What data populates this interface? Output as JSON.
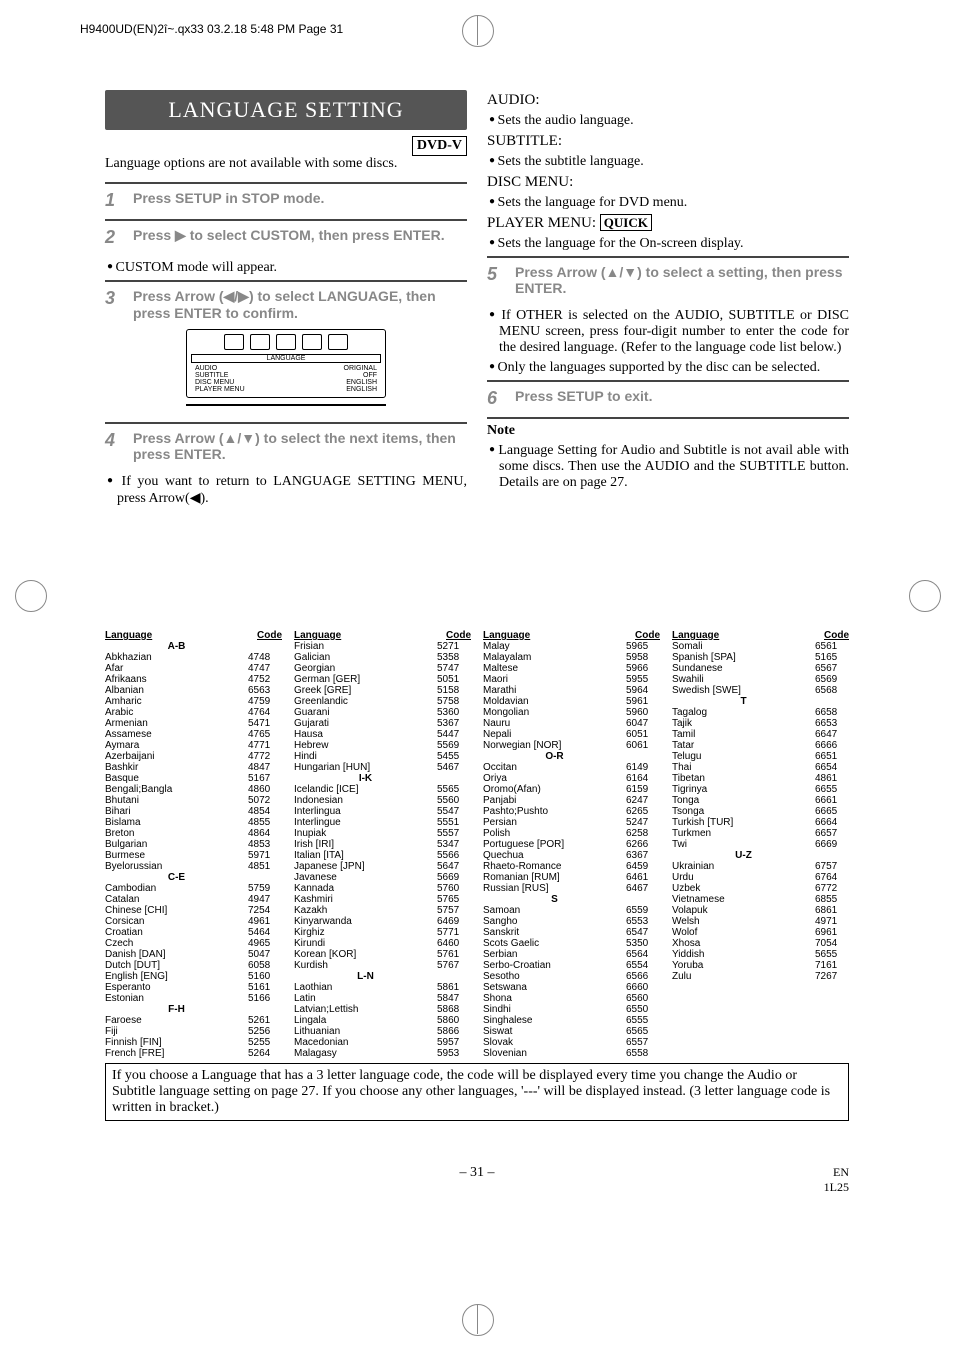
{
  "meta": {
    "header": "H9400UD(EN)2î~.qx33  03.2.18 5:48 PM  Page 31"
  },
  "left": {
    "title": "LANGUAGE SETTING",
    "badge": "DVD-V",
    "intro": "Language options are not available with some discs.",
    "step1": "Press SETUP in STOP mode.",
    "step2": "Press ▶ to select CUSTOM, then press ENTER.",
    "bullet2": "CUSTOM mode will appear.",
    "step3": "Press Arrow (◀/▶) to select LANGUAGE, then press ENTER to confirm.",
    "osd": {
      "label": "LANGUAGE",
      "rows": [
        {
          "k": "AUDIO",
          "v": "ORIGINAL"
        },
        {
          "k": "SUBTITLE",
          "v": "OFF"
        },
        {
          "k": "DISC MENU",
          "v": "ENGLISH"
        },
        {
          "k": "PLAYER MENU",
          "v": "ENGLISH"
        }
      ]
    },
    "step4": "Press Arrow (▲/▼) to select the next items, then press ENTER.",
    "bullet4": "If you want to return to LANGUAGE SETTING MENU, press Arrow(◀)."
  },
  "right": {
    "audio_h": "AUDIO:",
    "audio_b": "Sets the audio language.",
    "sub_h": "SUBTITLE:",
    "sub_b": "Sets the subtitle language.",
    "disc_h": "DISC MENU:",
    "disc_b": "Sets the language for DVD menu.",
    "player_h": "PLAYER MENU:",
    "quick": "QUICK",
    "player_b": "Sets the language for the On-screen display.",
    "step5": "Press Arrow (▲/▼) to select a setting, then press ENTER.",
    "bullet5a": "If OTHER is selected on the AUDIO, SUBTITLE or DISC MENU screen, press four-digit number to enter the code for the desired language. (Refer to the language code list below.)",
    "bullet5b": "Only the languages supported by the disc can be selected.",
    "step6": "Press SETUP to exit.",
    "note_h": "Note",
    "note_b": "Language Setting for Audio and Subtitle is not avail able with some discs. Then use the AUDIO and the SUBTITLE button. Details are on page 27."
  },
  "table": {
    "hdr_lang": "Language",
    "hdr_code": "Code",
    "col1": [
      {
        "s": "A-B"
      },
      {
        "l": "Abkhazian",
        "c": "4748"
      },
      {
        "l": "Afar",
        "c": "4747"
      },
      {
        "l": "Afrikaans",
        "c": "4752"
      },
      {
        "l": "Albanian",
        "c": "6563"
      },
      {
        "l": "Amharic",
        "c": "4759"
      },
      {
        "l": "Arabic",
        "c": "4764"
      },
      {
        "l": "Armenian",
        "c": "5471"
      },
      {
        "l": "Assamese",
        "c": "4765"
      },
      {
        "l": "Aymara",
        "c": "4771"
      },
      {
        "l": "Azerbaijani",
        "c": "4772"
      },
      {
        "l": "Bashkir",
        "c": "4847"
      },
      {
        "l": "Basque",
        "c": "5167"
      },
      {
        "l": "Bengali;Bangla",
        "c": "4860"
      },
      {
        "l": "Bhutani",
        "c": "5072"
      },
      {
        "l": "Bihari",
        "c": "4854"
      },
      {
        "l": "Bislama",
        "c": "4855"
      },
      {
        "l": "Breton",
        "c": "4864"
      },
      {
        "l": "Bulgarian",
        "c": "4853"
      },
      {
        "l": "Burmese",
        "c": "5971"
      },
      {
        "l": "Byelorussian",
        "c": "4851"
      },
      {
        "s": "C-E"
      },
      {
        "l": "Cambodian",
        "c": "5759"
      },
      {
        "l": "Catalan",
        "c": "4947"
      },
      {
        "l": "Chinese [CHI]",
        "c": "7254"
      },
      {
        "l": "Corsican",
        "c": "4961"
      },
      {
        "l": "Croatian",
        "c": "5464"
      },
      {
        "l": "Czech",
        "c": "4965"
      },
      {
        "l": "Danish [DAN]",
        "c": "5047"
      },
      {
        "l": "Dutch [DUT]",
        "c": "6058"
      },
      {
        "l": "English [ENG]",
        "c": "5160"
      },
      {
        "l": "Esperanto",
        "c": "5161"
      },
      {
        "l": "Estonian",
        "c": "5166"
      },
      {
        "s": "F-H"
      },
      {
        "l": "Faroese",
        "c": "5261"
      },
      {
        "l": "Fiji",
        "c": "5256"
      },
      {
        "l": "Finnish [FIN]",
        "c": "5255"
      },
      {
        "l": "French [FRE]",
        "c": "5264"
      }
    ],
    "col2": [
      {
        "l": "Frisian",
        "c": "5271"
      },
      {
        "l": "Galician",
        "c": "5358"
      },
      {
        "l": "Georgian",
        "c": "5747"
      },
      {
        "l": "German [GER]",
        "c": "5051"
      },
      {
        "l": "Greek [GRE]",
        "c": "5158"
      },
      {
        "l": "Greenlandic",
        "c": "5758"
      },
      {
        "l": "Guarani",
        "c": "5360"
      },
      {
        "l": "Gujarati",
        "c": "5367"
      },
      {
        "l": "Hausa",
        "c": "5447"
      },
      {
        "l": "Hebrew",
        "c": "5569"
      },
      {
        "l": "Hindi",
        "c": "5455"
      },
      {
        "l": "Hungarian [HUN]",
        "c": "5467"
      },
      {
        "s": "I-K"
      },
      {
        "l": "Icelandic [ICE]",
        "c": "5565"
      },
      {
        "l": "Indonesian",
        "c": "5560"
      },
      {
        "l": "Interlingua",
        "c": "5547"
      },
      {
        "l": "Interlingue",
        "c": "5551"
      },
      {
        "l": "Inupiak",
        "c": "5557"
      },
      {
        "l": "Irish [IRI]",
        "c": "5347"
      },
      {
        "l": "Italian [ITA]",
        "c": "5566"
      },
      {
        "l": "Japanese [JPN]",
        "c": "5647"
      },
      {
        "l": "Javanese",
        "c": "5669"
      },
      {
        "l": "Kannada",
        "c": "5760"
      },
      {
        "l": "Kashmiri",
        "c": "5765"
      },
      {
        "l": "Kazakh",
        "c": "5757"
      },
      {
        "l": "Kinyarwanda",
        "c": "6469"
      },
      {
        "l": "Kirghiz",
        "c": "5771"
      },
      {
        "l": "Kirundi",
        "c": "6460"
      },
      {
        "l": "Korean [KOR]",
        "c": "5761"
      },
      {
        "l": "Kurdish",
        "c": "5767"
      },
      {
        "s": "L-N"
      },
      {
        "l": "Laothian",
        "c": "5861"
      },
      {
        "l": "Latin",
        "c": "5847"
      },
      {
        "l": "Latvian;Lettish",
        "c": "5868"
      },
      {
        "l": "Lingala",
        "c": "5860"
      },
      {
        "l": "Lithuanian",
        "c": "5866"
      },
      {
        "l": "Macedonian",
        "c": "5957"
      },
      {
        "l": "Malagasy",
        "c": "5953"
      }
    ],
    "col3": [
      {
        "l": "Malay",
        "c": "5965"
      },
      {
        "l": "Malayalam",
        "c": "5958"
      },
      {
        "l": "Maltese",
        "c": "5966"
      },
      {
        "l": "Maori",
        "c": "5955"
      },
      {
        "l": "Marathi",
        "c": "5964"
      },
      {
        "l": "Moldavian",
        "c": "5961"
      },
      {
        "l": "Mongolian",
        "c": "5960"
      },
      {
        "l": "Nauru",
        "c": "6047"
      },
      {
        "l": "Nepali",
        "c": "6051"
      },
      {
        "l": "Norwegian [NOR]",
        "c": "6061"
      },
      {
        "s": "O-R"
      },
      {
        "l": "Occitan",
        "c": "6149"
      },
      {
        "l": "Oriya",
        "c": "6164"
      },
      {
        "l": "Oromo(Afan)",
        "c": "6159"
      },
      {
        "l": "Panjabi",
        "c": "6247"
      },
      {
        "l": "Pashto;Pushto",
        "c": "6265"
      },
      {
        "l": "Persian",
        "c": "5247"
      },
      {
        "l": "Polish",
        "c": "6258"
      },
      {
        "l": "Portuguese [POR]",
        "c": "6266"
      },
      {
        "l": "Quechua",
        "c": "6367"
      },
      {
        "l": "Rhaeto-Romance",
        "c": "6459"
      },
      {
        "l": "Romanian [RUM]",
        "c": "6461"
      },
      {
        "l": "Russian [RUS]",
        "c": "6467"
      },
      {
        "s": "S"
      },
      {
        "l": "Samoan",
        "c": "6559"
      },
      {
        "l": "Sangho",
        "c": "6553"
      },
      {
        "l": "Sanskrit",
        "c": "6547"
      },
      {
        "l": "Scots Gaelic",
        "c": "5350"
      },
      {
        "l": "Serbian",
        "c": "6564"
      },
      {
        "l": "Serbo-Croatian",
        "c": "6554"
      },
      {
        "l": "Sesotho",
        "c": "6566"
      },
      {
        "l": "Setswana",
        "c": "6660"
      },
      {
        "l": "Shona",
        "c": "6560"
      },
      {
        "l": "Sindhi",
        "c": "6550"
      },
      {
        "l": "Singhalese",
        "c": "6555"
      },
      {
        "l": "Siswat",
        "c": "6565"
      },
      {
        "l": "Slovak",
        "c": "6557"
      },
      {
        "l": "Slovenian",
        "c": "6558"
      }
    ],
    "col4": [
      {
        "l": "Somali",
        "c": "6561"
      },
      {
        "l": "Spanish [SPA]",
        "c": "5165"
      },
      {
        "l": "Sundanese",
        "c": "6567"
      },
      {
        "l": "Swahili",
        "c": "6569"
      },
      {
        "l": "Swedish [SWE]",
        "c": "6568"
      },
      {
        "s": "T"
      },
      {
        "l": "Tagalog",
        "c": "6658"
      },
      {
        "l": "Tajik",
        "c": "6653"
      },
      {
        "l": "Tamil",
        "c": "6647"
      },
      {
        "l": "Tatar",
        "c": "6666"
      },
      {
        "l": "Telugu",
        "c": "6651"
      },
      {
        "l": "Thai",
        "c": "6654"
      },
      {
        "l": "Tibetan",
        "c": "4861"
      },
      {
        "l": "Tigrinya",
        "c": "6655"
      },
      {
        "l": "Tonga",
        "c": "6661"
      },
      {
        "l": "Tsonga",
        "c": "6665"
      },
      {
        "l": "Turkish [TUR]",
        "c": "6664"
      },
      {
        "l": "Turkmen",
        "c": "6657"
      },
      {
        "l": "Twi",
        "c": "6669"
      },
      {
        "s": "U-Z"
      },
      {
        "l": "Ukrainian",
        "c": "6757"
      },
      {
        "l": "Urdu",
        "c": "6764"
      },
      {
        "l": "Uzbek",
        "c": "6772"
      },
      {
        "l": "Vietnamese",
        "c": "6855"
      },
      {
        "l": "Volapuk",
        "c": "6861"
      },
      {
        "l": "Welsh",
        "c": "4971"
      },
      {
        "l": "Wolof",
        "c": "6961"
      },
      {
        "l": "Xhosa",
        "c": "7054"
      },
      {
        "l": "Yiddish",
        "c": "5655"
      },
      {
        "l": "Yoruba",
        "c": "7161"
      },
      {
        "l": "Zulu",
        "c": "7267"
      }
    ]
  },
  "footnote": "If you choose a Language that has a 3 letter language code, the code will be displayed every time you change the Audio or Subtitle language setting on page 27. If you choose any other languages, '---' will be displayed instead. (3 letter language code is written in bracket.)",
  "footer": {
    "page": "– 31 –",
    "en": "EN",
    "code": "1L25"
  }
}
